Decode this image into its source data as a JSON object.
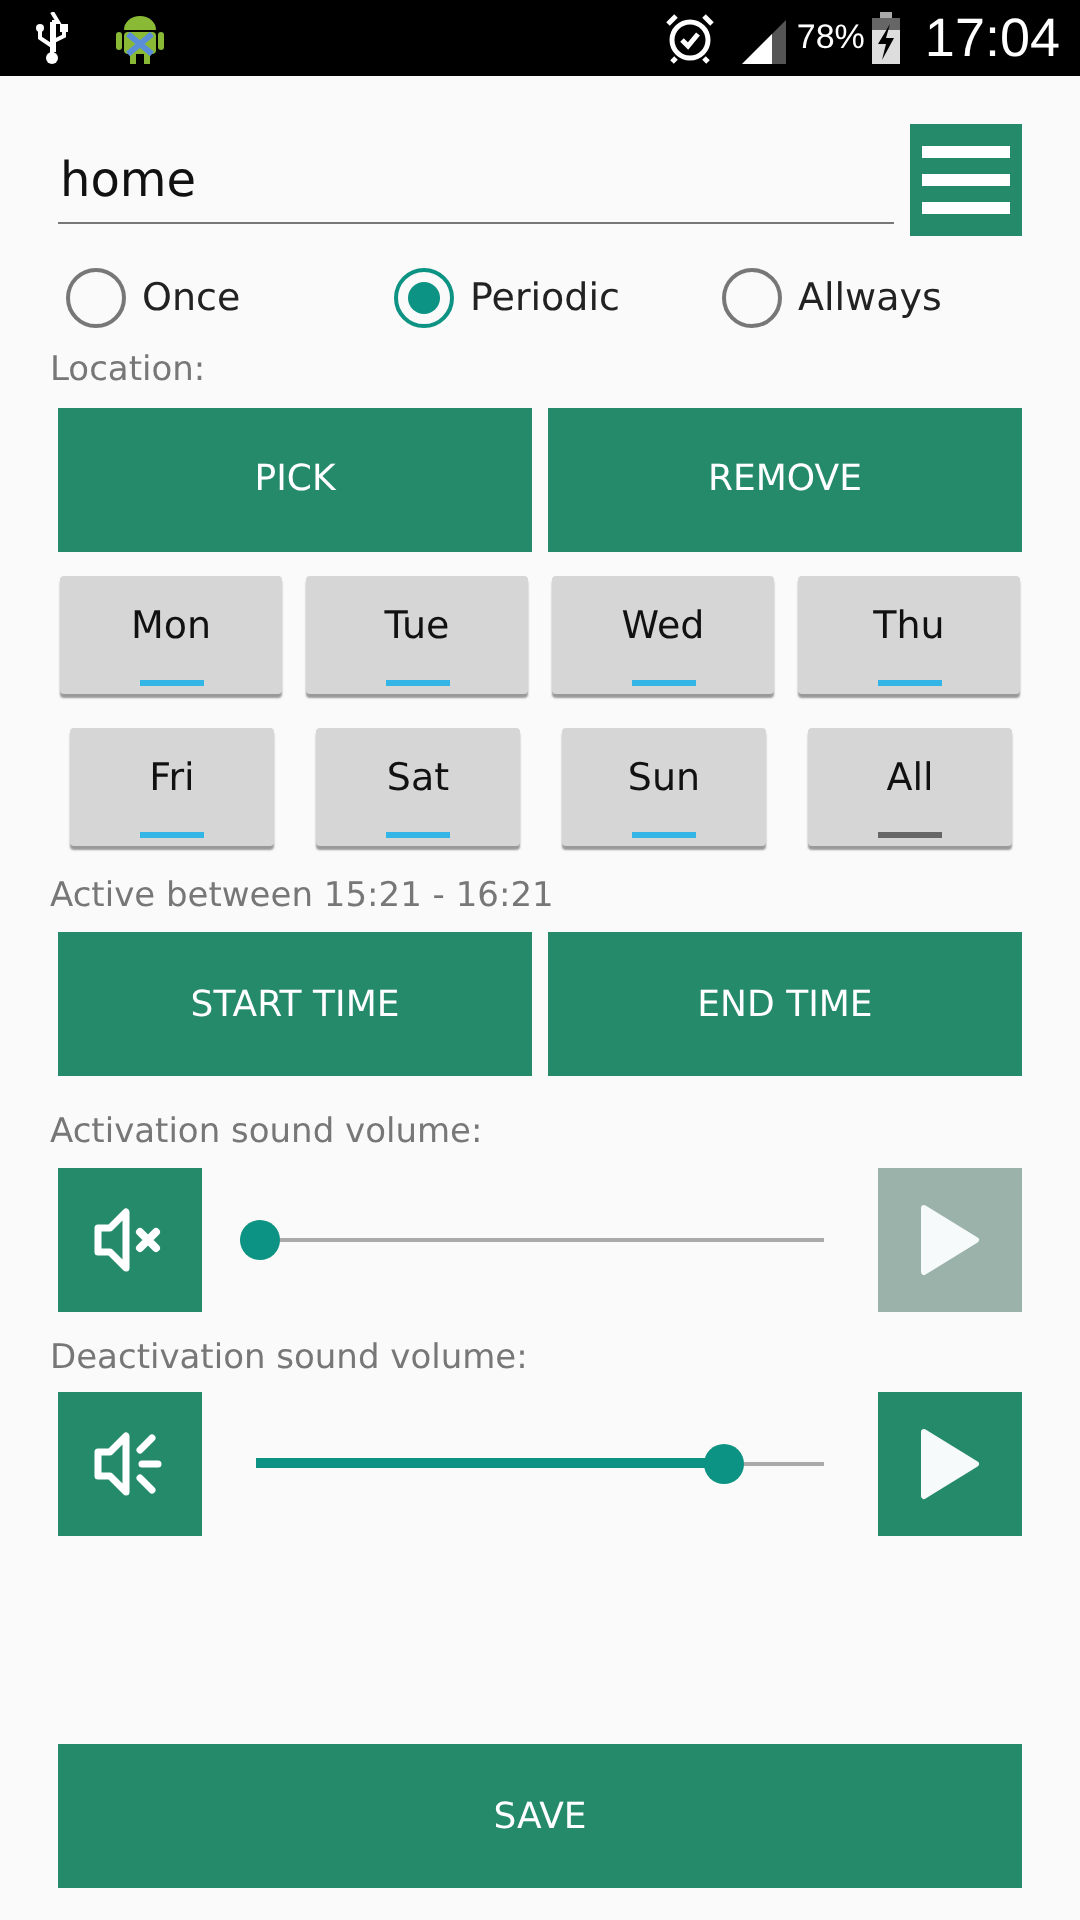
{
  "status_bar": {
    "battery": "78%",
    "time": "17:04"
  },
  "name_field": {
    "value": "home"
  },
  "modes": [
    {
      "label": "Once",
      "selected": false
    },
    {
      "label": "Periodic",
      "selected": true
    },
    {
      "label": "Allways",
      "selected": false
    }
  ],
  "location_label": "Location:",
  "location_buttons": [
    "PICK",
    "REMOVE"
  ],
  "days": [
    {
      "label": "Mon",
      "selected": true
    },
    {
      "label": "Tue",
      "selected": true
    },
    {
      "label": "Wed",
      "selected": true
    },
    {
      "label": "Thu",
      "selected": true
    },
    {
      "label": "Fri",
      "selected": true
    },
    {
      "label": "Sat",
      "selected": true
    },
    {
      "label": "Sun",
      "selected": true
    },
    {
      "label": "All",
      "selected": false
    }
  ],
  "active_label": "Active between 15:21 - 16:21",
  "time_buttons": [
    "START TIME",
    "END TIME"
  ],
  "sounds": [
    {
      "label": "Activation sound volume:",
      "muted": true,
      "level": 0,
      "play_disabled": true
    },
    {
      "label": "Deactivation sound volume:",
      "muted": false,
      "level": 0.85,
      "play_disabled": false
    }
  ],
  "save_button": "SAVE"
}
